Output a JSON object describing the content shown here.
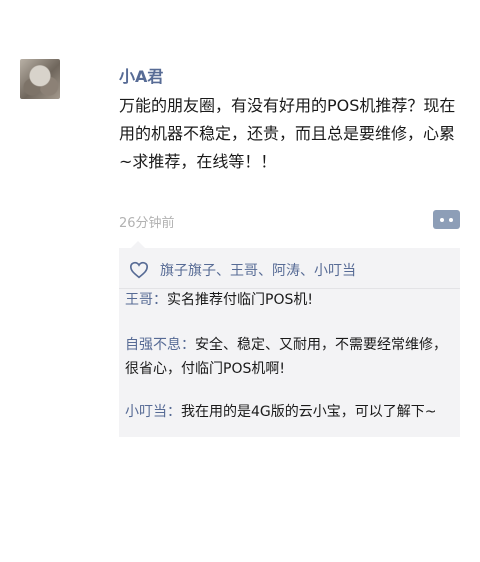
{
  "post": {
    "username": "小A君",
    "text": "万能的朋友圈，有没有好用的POS机推荐？现在用的机器不稳定，还贵，而且总是要维修，心累~求推荐，在线等！！",
    "timestamp": "26分钟前"
  },
  "likes": {
    "names": "旗子旗子、王哥、阿涛、小叮当"
  },
  "comments": [
    {
      "author": "王哥：",
      "text": "实名推荐付临门POS机!"
    },
    {
      "author": "自强不息：",
      "text": "安全、稳定、又耐用，不需要经常维修，很省心，付临门POS机啊!"
    },
    {
      "author": "小叮当：",
      "text": "我在用的是4G版的云小宝，可以了解下~"
    }
  ],
  "colors": {
    "link": "#576b95",
    "panel": "#f3f3f5",
    "comment_button": "#8d9eb7"
  },
  "icons": {
    "avatar": "avatar-photo",
    "like": "heart-icon",
    "comment": "comment-dots-icon"
  }
}
